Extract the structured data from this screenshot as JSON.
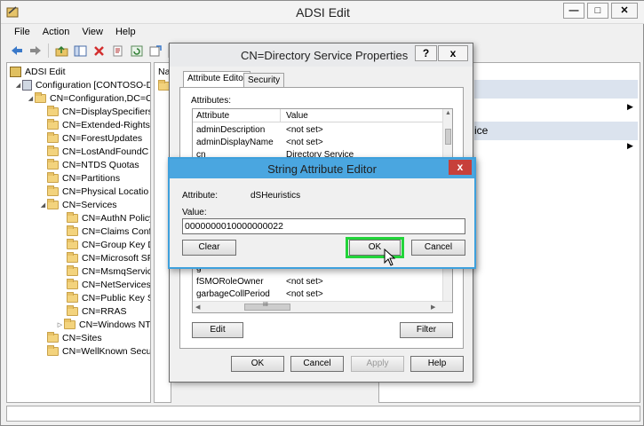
{
  "window": {
    "title": "ADSI Edit"
  },
  "menu": [
    "File",
    "Action",
    "View",
    "Help"
  ],
  "tree": {
    "root": "ADSI Edit",
    "config": "Configuration [CONTOSO-D",
    "config_dn": "CN=Configuration,DC=C",
    "items": [
      "CN=DisplaySpecifiers",
      "CN=Extended-Rights",
      "CN=ForestUpdates",
      "CN=LostAndFoundC",
      "CN=NTDS Quotas",
      "CN=Partitions",
      "CN=Physical Locatio",
      "CN=Services"
    ],
    "services_children": [
      "CN=AuthN Policy",
      "CN=Claims Confi",
      "CN=Group Key D",
      "CN=Microsoft SP",
      "CN=MsmqService",
      "CN=NetServices",
      "CN=Public Key Se",
      "CN=RRAS",
      "CN=Windows NT"
    ],
    "tail_items": [
      "CN=Sites",
      "CN=WellKnown Secu"
    ]
  },
  "middle": {
    "header": "Na"
  },
  "actions": {
    "section2_fragment": "ice"
  },
  "properties_dialog": {
    "title": "CN=Directory Service Properties",
    "help_label": "?",
    "close_label": "x",
    "tabs": [
      "Attribute Editor",
      "Security"
    ],
    "attributes_label": "Attributes:",
    "columns": [
      "Attribute",
      "Value"
    ],
    "rows_top": [
      {
        "attr": "adminDescription",
        "value": "<not set>"
      },
      {
        "attr": "adminDisplayName",
        "value": "<not set>"
      },
      {
        "attr": "cn",
        "value": "Directory Service"
      }
    ],
    "rows_bottom": [
      {
        "attr": "fSMORoleOwner",
        "value": "<not set>"
      },
      {
        "attr": "garbageCollPeriod",
        "value": "<not set>"
      }
    ],
    "partial_row_attr": "g",
    "scroll_thumb_label": "III",
    "edit_button": "Edit",
    "filter_button": "Filter",
    "ok_button": "OK",
    "cancel_button": "Cancel",
    "apply_button": "Apply",
    "help_button": "Help"
  },
  "string_editor": {
    "title": "String Attribute Editor",
    "close_label": "x",
    "attribute_label": "Attribute:",
    "attribute_value": "dSHeuristics",
    "value_label": "Value:",
    "value": "0000000010000000022",
    "clear_button": "Clear",
    "ok_button": "OK",
    "cancel_button": "Cancel"
  },
  "colors": {
    "accent": "#4aa6e0",
    "close_red": "#c7403a",
    "highlight_green": "#22d43a",
    "folder_yellow": "#f3d37d"
  }
}
